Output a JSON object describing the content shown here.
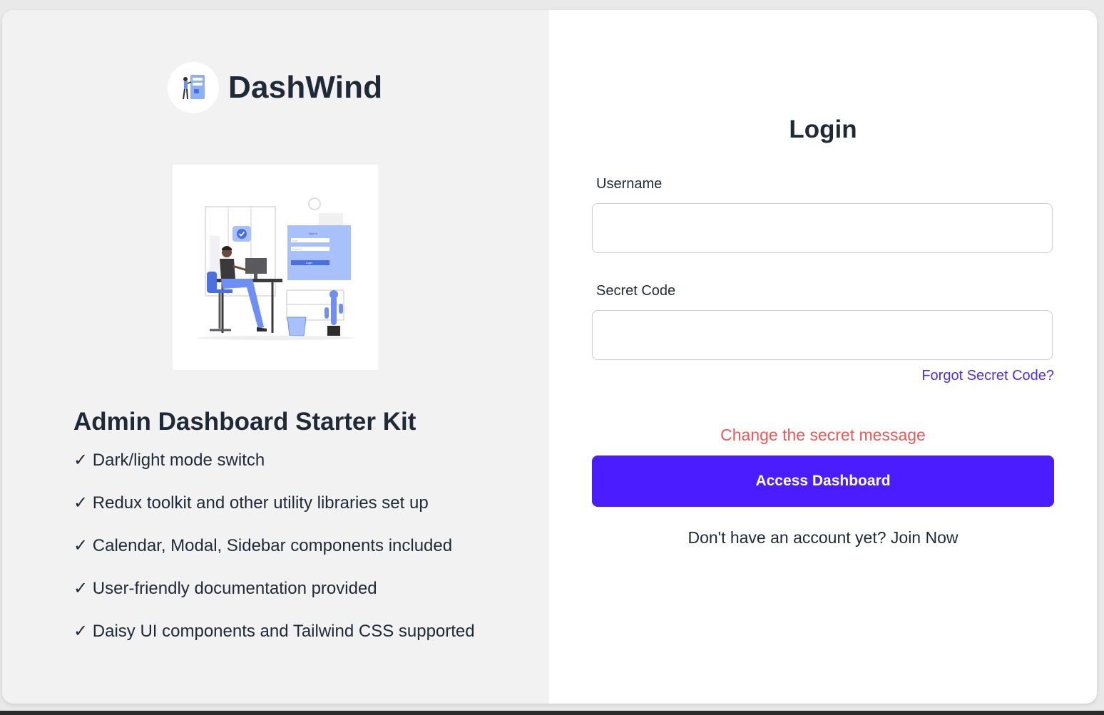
{
  "app": {
    "name": "DashWind"
  },
  "left": {
    "kit_title": "Admin Dashboard Starter Kit",
    "features": [
      "✓ Dark/light mode switch",
      "✓ Redux toolkit and other utility libraries set up",
      "✓ Calendar, Modal, Sidebar components included",
      "✓ User-friendly documentation provided",
      "✓ Daisy UI components and Tailwind CSS supported"
    ],
    "illustration": {
      "sign_in_text": "Sign in",
      "email_text": "Email",
      "password_text": "Password",
      "login_text": "Login"
    }
  },
  "login": {
    "title": "Login",
    "username_label": "Username",
    "username_value": "",
    "secret_label": "Secret Code",
    "secret_value": "",
    "forgot_link": "Forgot Secret Code?",
    "secret_message": "Change the secret message",
    "access_button": "Access Dashboard",
    "signup_prompt": "Don't have an account yet?",
    "join_link": "Join Now"
  },
  "colors": {
    "primary": "#4b1cff",
    "link": "#4f2cf2",
    "error": "#f25656",
    "accent_blue": "#6e8ff5"
  }
}
